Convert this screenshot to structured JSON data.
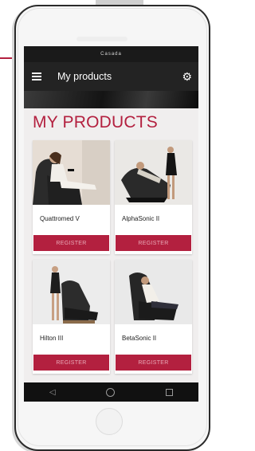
{
  "status_bar": {
    "brand": "Casada"
  },
  "app_bar": {
    "title": "My products",
    "menu_icon": "hamburger-icon",
    "settings_icon": "gear-icon"
  },
  "page": {
    "heading": "MY PRODUCTS"
  },
  "products": [
    {
      "name": "Quattromed V",
      "button": "REGISTER"
    },
    {
      "name": "AlphaSonic II",
      "button": "REGISTER"
    },
    {
      "name": "Hilton III",
      "button": "REGISTER"
    },
    {
      "name": "BetaSonic II",
      "button": "REGISTER"
    }
  ],
  "colors": {
    "accent": "#b3203f",
    "app_bar": "#232323",
    "status_bar": "#1a1a1a",
    "nav_bar": "#111111"
  },
  "nav": {
    "back_icon": "back-triangle-icon",
    "home_icon": "home-circle-icon",
    "recents_icon": "recents-square-icon"
  }
}
